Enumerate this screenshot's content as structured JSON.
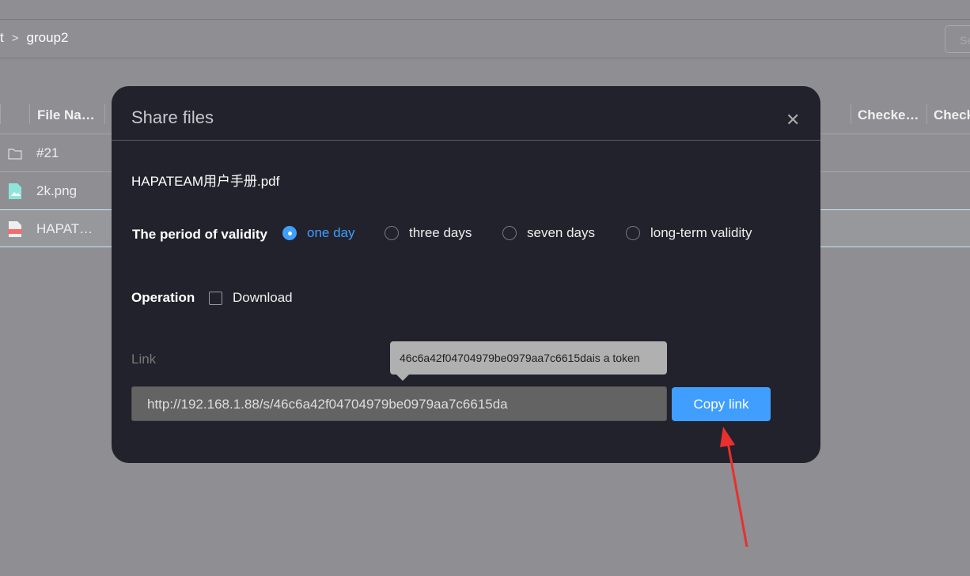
{
  "breadcrumb": {
    "prev": "t",
    "separator": ">",
    "current": "group2"
  },
  "search": {
    "placeholder": "Se"
  },
  "table": {
    "headers": [
      "File Na…",
      "Checke…",
      "Check"
    ],
    "rows": [
      {
        "icon": "folder-icon",
        "name": "#21",
        "selected": false
      },
      {
        "icon": "image-file-icon",
        "name": "2k.png",
        "selected": false
      },
      {
        "icon": "pdf-file-icon",
        "name": "HAPAT…",
        "selected": true
      }
    ]
  },
  "modal": {
    "title": "Share files",
    "file_name": "HAPATEAM用户手册.pdf",
    "validity_label": "The period of validity",
    "validity_options": [
      {
        "label": "one day",
        "selected": true
      },
      {
        "label": "three days",
        "selected": false
      },
      {
        "label": "seven days",
        "selected": false
      },
      {
        "label": "long-term validity",
        "selected": false
      }
    ],
    "operation_label": "Operation",
    "download_label": "Download",
    "download_checked": false,
    "link_label": "Link",
    "tooltip": "46c6a42f04704979be0979aa7c6615dais a token",
    "link_value": "http://192.168.1.88/s/46c6a42f04704979be0979aa7c6615da",
    "copy_label": "Copy link"
  },
  "colors": {
    "accent": "#409eff",
    "annotation_arrow": "#e8302e",
    "modal_bg": "#22222c"
  }
}
